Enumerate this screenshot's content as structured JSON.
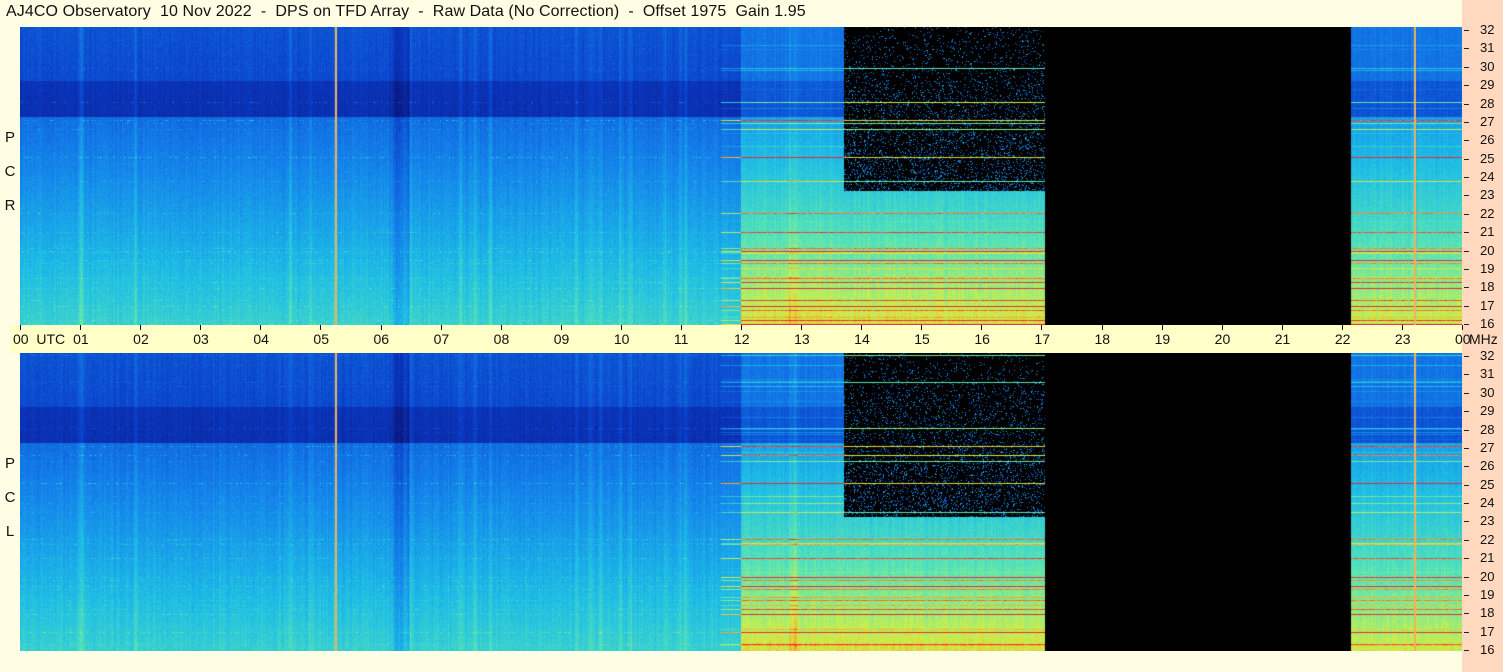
{
  "title": "AJ4CO Observatory  10 Nov 2022  -  DPS on TFD Array  -  Raw Data (No Correction)  -  Offset 1975  Gain 1.95",
  "panels": [
    {
      "name": "rcp",
      "label": [
        "R",
        "C",
        "P"
      ]
    },
    {
      "name": "lcp",
      "label": [
        "L",
        "C",
        "P"
      ]
    }
  ],
  "time_axis": {
    "unit_label": "UTC",
    "ticks": [
      "00",
      "01",
      "02",
      "03",
      "04",
      "05",
      "06",
      "07",
      "08",
      "09",
      "10",
      "11",
      "12",
      "13",
      "14",
      "15",
      "16",
      "17",
      "18",
      "19",
      "20",
      "21",
      "22",
      "23",
      "00"
    ]
  },
  "freq_axis": {
    "unit_label": "MHz",
    "ticks": [
      "32",
      "31",
      "30",
      "29",
      "28",
      "27",
      "26",
      "25",
      "24",
      "23",
      "22",
      "21",
      "20",
      "19",
      "18",
      "17",
      "16"
    ]
  },
  "colors": {
    "background": "#fffde3",
    "time_bar": "#ffffc8",
    "side_bar": "#ffd9bf",
    "marker": "#f0b060"
  },
  "chart_data": {
    "type": "heatmap",
    "title": "AJ4CO Observatory  10 Nov 2022  -  DPS on TFD Array  -  Raw Data (No Correction)  -  Offset 1975  Gain 1.95",
    "x_label": "UTC",
    "y_label": "MHz",
    "x_range_hours": [
      0,
      24
    ],
    "y_range_mhz": [
      16,
      32
    ],
    "polarizations": [
      "RCP",
      "LCP"
    ],
    "no_data_intervals_utc": [
      [
        13.7,
        17.05
      ],
      [
        17.05,
        22.15
      ]
    ],
    "marker_lines_utc": [
      5.25,
      23.2
    ],
    "strong_rfi_bands_mhz": [
      25,
      27,
      17,
      18,
      20,
      21
    ]
  }
}
